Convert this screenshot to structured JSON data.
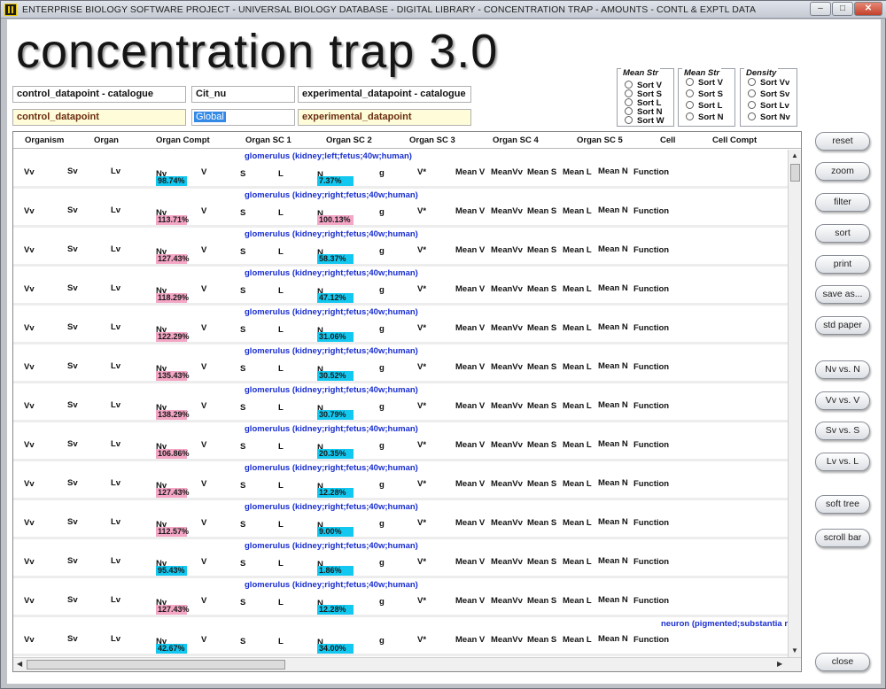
{
  "window": {
    "title": "ENTERPRISE BIOLOGY SOFTWARE PROJECT  -  UNIVERSAL BIOLOGY DATABASE  -  DIGITAL LIBRARY  -  CONCENTRATION TRAP  -  AMOUNTS  -  CONTL & EXPTL DATA",
    "min": "–",
    "max": "□",
    "close": "✕"
  },
  "app_title": "concentration trap 3.0",
  "fields": {
    "control_catalogue": "control_datapoint - catalogue",
    "cit_nu": "Cit_nu",
    "experimental_catalogue": "experimental_datapoint - catalogue",
    "control_datapoint": "control_datapoint",
    "global": "Global",
    "experimental_datapoint": "experimental_datapoint"
  },
  "radio_groups": [
    {
      "legend": "Mean Str",
      "options": [
        "Sort V",
        "Sort S",
        "Sort L",
        "Sort N",
        "Sort W"
      ]
    },
    {
      "legend": "Mean Str",
      "options": [
        "Sort V",
        "Sort S",
        "Sort L",
        "Sort N"
      ]
    },
    {
      "legend": "Density",
      "options": [
        "Sort Vv",
        "Sort Sv",
        "Sort Lv",
        "Sort Nv"
      ]
    }
  ],
  "columns": [
    "Organism",
    "Organ",
    "Organ Compt",
    "Organ SC 1",
    "Organ SC 2",
    "Organ SC 3",
    "Organ SC 4",
    "Organ SC 5",
    "Cell",
    "Cell Compt"
  ],
  "row_labels": {
    "vv": "Vv",
    "sv": "Sv",
    "lv": "Lv",
    "nv": "Nv",
    "v": "V",
    "s": "S",
    "l": "L",
    "n": "N",
    "g": "g",
    "vstar": "V*",
    "meanv": "Mean V",
    "meanvv": "MeanVv",
    "means": "Mean S",
    "meanl": "Mean L",
    "meann": "Mean N",
    "function": "Function"
  },
  "rows": [
    {
      "name": "glomerulus (kidney;left;fetus;40w;human)",
      "nv_pct": "98.74%",
      "nv_color": "cyan",
      "n_pct": "7.37%",
      "n_color": "cyan"
    },
    {
      "name": "glomerulus (kidney;right;fetus;40w;human)",
      "nv_pct": "113.71%",
      "nv_color": "pink",
      "n_pct": "100.13%",
      "n_color": "pink"
    },
    {
      "name": "glomerulus (kidney;right;fetus;40w;human)",
      "nv_pct": "127.43%",
      "nv_color": "pink",
      "n_pct": "58.37%",
      "n_color": "cyan"
    },
    {
      "name": "glomerulus (kidney;right;fetus;40w;human)",
      "nv_pct": "118.29%",
      "nv_color": "pink",
      "n_pct": "47.12%",
      "n_color": "cyan"
    },
    {
      "name": "glomerulus (kidney;right;fetus;40w;human)",
      "nv_pct": "122.29%",
      "nv_color": "pink",
      "n_pct": "31.06%",
      "n_color": "cyan"
    },
    {
      "name": "glomerulus (kidney;right;fetus;40w;human)",
      "nv_pct": "135.43%",
      "nv_color": "pink",
      "n_pct": "30.52%",
      "n_color": "cyan"
    },
    {
      "name": "glomerulus (kidney;right;fetus;40w;human)",
      "nv_pct": "138.29%",
      "nv_color": "pink",
      "n_pct": "30.79%",
      "n_color": "cyan"
    },
    {
      "name": "glomerulus (kidney;right;fetus;40w;human)",
      "nv_pct": "106.86%",
      "nv_color": "pink",
      "n_pct": "20.35%",
      "n_color": "cyan"
    },
    {
      "name": "glomerulus (kidney;right;fetus;40w;human)",
      "nv_pct": "127.43%",
      "nv_color": "pink",
      "n_pct": "12.28%",
      "n_color": "cyan"
    },
    {
      "name": "glomerulus (kidney;right;fetus;40w;human)",
      "nv_pct": "112.57%",
      "nv_color": "pink",
      "n_pct": "9.00%",
      "n_color": "cyan"
    },
    {
      "name": "glomerulus (kidney;right;fetus;40w;human)",
      "nv_pct": "95.43%",
      "nv_color": "cyan",
      "n_pct": "1.86%",
      "n_color": "cyan"
    },
    {
      "name": "glomerulus (kidney;right;fetus;40w;human)",
      "nv_pct": "127.43%",
      "nv_color": "pink",
      "n_pct": "12.28%",
      "n_color": "cyan"
    },
    {
      "name": "neuron (pigmented;substantia n",
      "nv_pct": "42.67%",
      "nv_color": "cyan",
      "n_pct": "34.00%",
      "n_color": "cyan"
    }
  ],
  "buttons": {
    "reset": "reset",
    "zoom": "zoom",
    "filter": "filter",
    "sort": "sort",
    "print": "print",
    "save_as": "save as...",
    "std_paper": "std paper",
    "nv_vs_n": "Nv vs. N",
    "vv_vs_v": "Vv vs. V",
    "sv_vs_s": "Sv vs. S",
    "lv_vs_l": "Lv vs. L",
    "soft_tree": "soft tree",
    "scroll_bar": "scroll bar",
    "close": "close"
  },
  "colors": {
    "pink_bar": "#f4a6c4",
    "cyan_bar": "#13c8f0",
    "row_name": "#1a2fcf",
    "yellow_field": "#fffdd9"
  }
}
